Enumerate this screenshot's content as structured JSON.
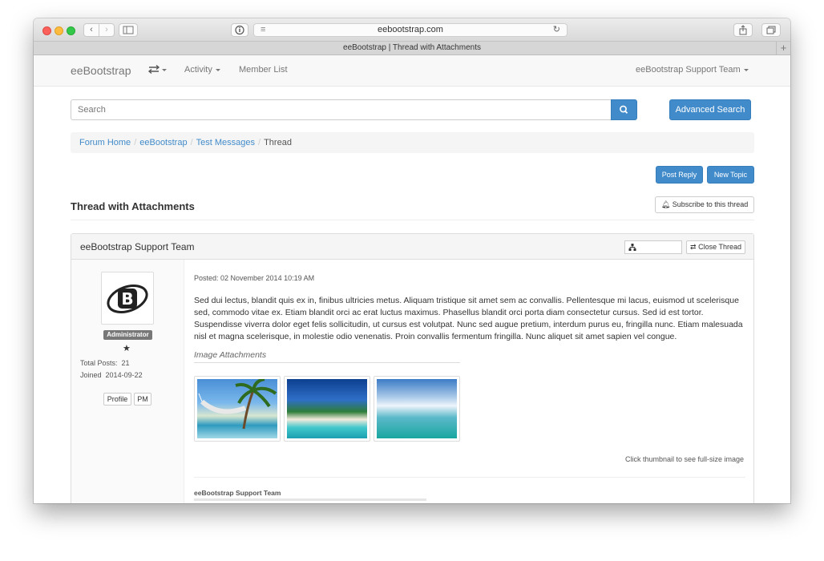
{
  "browser": {
    "url": "eebootstrap.com",
    "tab_title": "eeBootstrap | Thread with Attachments",
    "new_tab": "+"
  },
  "navbar": {
    "brand": "eeBootstrap",
    "activity": "Activity",
    "member_list": "Member List",
    "user_menu": "eeBootstrap Support Team"
  },
  "search": {
    "placeholder": "Search",
    "advanced_label": "Advanced Search"
  },
  "breadcrumb": {
    "items": [
      "Forum Home",
      "eeBootstrap",
      "Test Messages"
    ],
    "current": "Thread",
    "separator": "/"
  },
  "actions": {
    "post_reply": "Post Reply",
    "new_topic": "New Topic"
  },
  "thread": {
    "title": "Thread with Attachments",
    "subscribe_label": "Subscribe to this thread"
  },
  "post": {
    "author": "eeBootstrap Support Team",
    "close_label": "Close Thread",
    "avatar_letter": "B",
    "role": "Administrator",
    "total_posts_label": "Total Posts:",
    "total_posts": "21",
    "joined_label": "Joined",
    "joined": "2014-09-22",
    "profile_label": "Profile",
    "pm_label": "PM",
    "posted": "Posted: 02 November 2014 10:19 AM",
    "body": "Sed dui lectus, blandit quis ex in, finibus ultricies metus. Aliquam tristique sit amet sem ac convallis. Pellentesque mi lacus, euismod ut scelerisque sed, commodo vitae ex. Etiam blandit orci ac erat luctus maximus. Phasellus blandit orci porta diam consectetur cursus. Sed id est tortor. Suspendisse viverra dolor eget felis sollicitudin, ut cursus est volutpat. Nunc sed augue pretium, interdum purus eu, fringilla nunc. Etiam malesuada nisl et magna scelerisque, in molestie odio venenatis. Proin convallis fermentum fringilla. Nunc aliquet sit amet sapien vel congue.",
    "attachments_label": "Image Attachments",
    "thumbnail_note": "Click thumbnail to see full-size image",
    "signature_name": "eeBootstrap Support Team"
  },
  "colors": {
    "primary": "#428bca",
    "role_badge": "#777777"
  }
}
